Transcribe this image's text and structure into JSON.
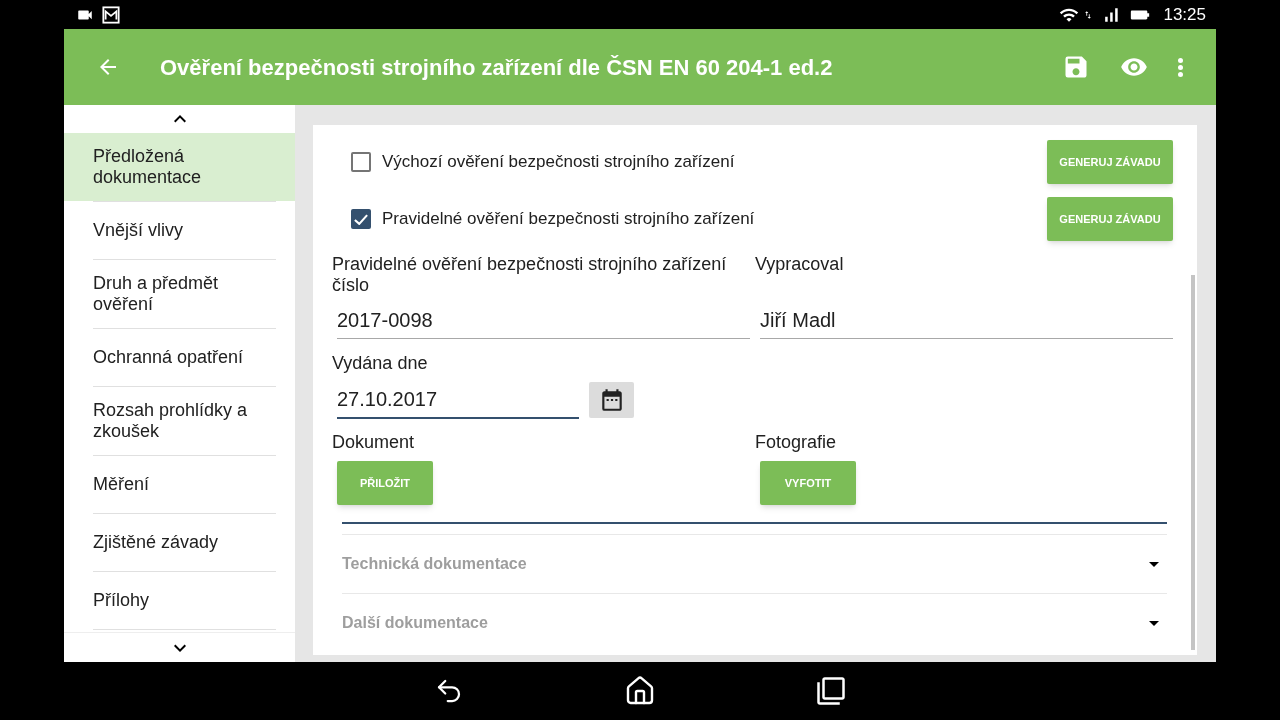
{
  "status_bar": {
    "time": "13:25"
  },
  "app_bar": {
    "title": "Ověření bezpečnosti strojního zařízení dle ČSN EN 60 204-1 ed.2"
  },
  "sidebar": {
    "items": [
      {
        "label": "Předložená dokumentace",
        "selected": true
      },
      {
        "label": "Vnější vlivy",
        "selected": false
      },
      {
        "label": "Druh a předmět ověření",
        "selected": false
      },
      {
        "label": "Ochranná opatření",
        "selected": false
      },
      {
        "label": "Rozsah prohlídky a zkoušek",
        "selected": false
      },
      {
        "label": "Měření",
        "selected": false
      },
      {
        "label": "Zjištěné závady",
        "selected": false
      },
      {
        "label": "Přílohy",
        "selected": false
      }
    ]
  },
  "form": {
    "checks": [
      {
        "label": "Výchozí ověření bezpečnosti strojního zařízení",
        "checked": false,
        "button": "GENERUJ ZÁVADU"
      },
      {
        "label": "Pravidelné ověření bezpečnosti strojního zařízení",
        "checked": true,
        "button": "GENERUJ ZÁVADU"
      }
    ],
    "fields": [
      {
        "label": "Pravidelné ověření bezpečnosti strojního zařízení číslo",
        "value": "2017-0098"
      },
      {
        "label": "Vypracoval",
        "value": "Jiří Madl"
      }
    ],
    "date_field": {
      "label": "Vydána dne",
      "value": "27.10.2017",
      "focused": true
    },
    "attachments": [
      {
        "label": "Dokument",
        "button": "PŘILOŽIT"
      },
      {
        "label": "Fotografie",
        "button": "VYFOTIT"
      }
    ],
    "sections": [
      {
        "title": "Technická dokumentace",
        "expanded": false
      },
      {
        "title": "Další dokumentace",
        "expanded": false
      }
    ]
  }
}
